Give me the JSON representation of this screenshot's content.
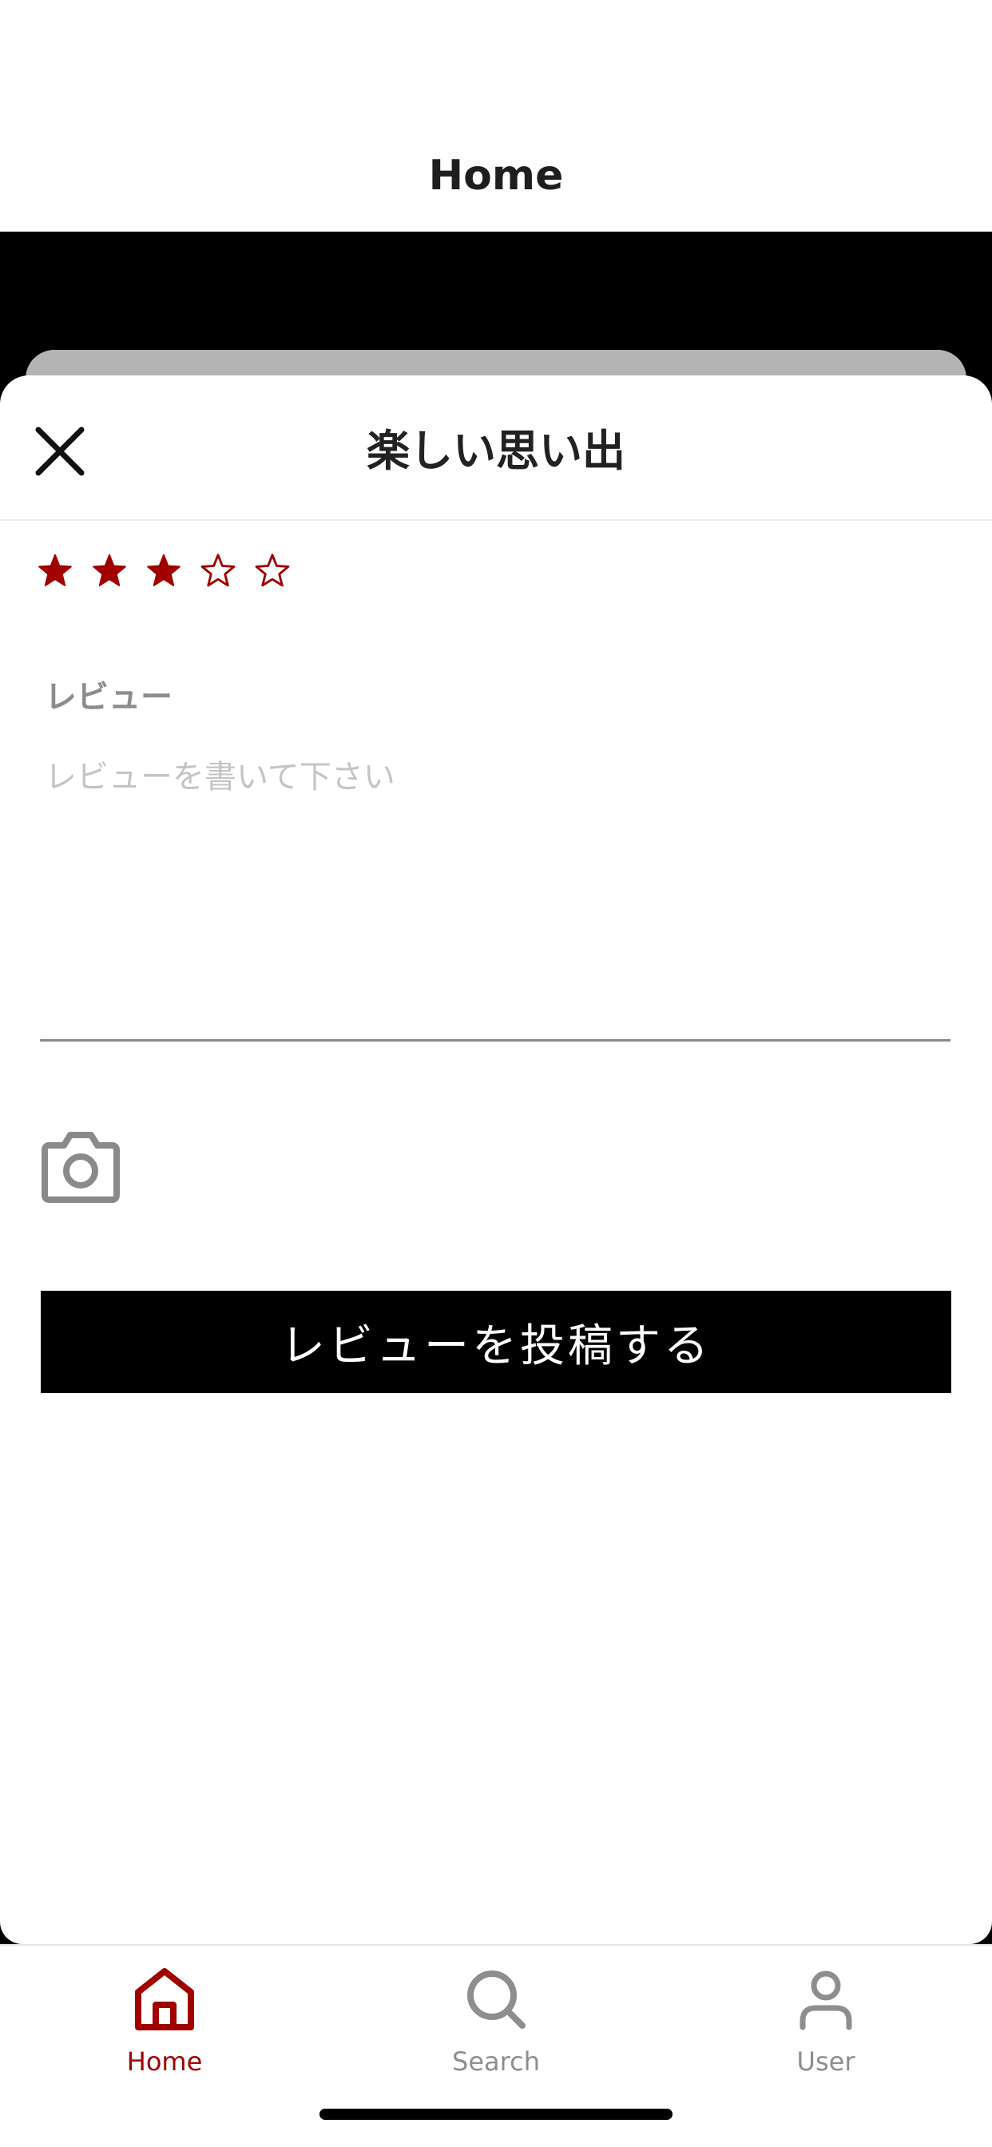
{
  "header": {
    "title": "Home"
  },
  "sheet": {
    "title": "楽しい思い出",
    "close_icon": "close-icon",
    "rating": {
      "value": 3,
      "max": 5,
      "color": "#a00000"
    },
    "review": {
      "label": "レビュー",
      "value": "",
      "placeholder": "レビューを書いて下さい"
    },
    "camera_icon": "camera-icon",
    "submit_label": "レビューを投稿する"
  },
  "tabs": [
    {
      "label": "Home",
      "icon": "home-icon",
      "active": true
    },
    {
      "label": "Search",
      "icon": "search-icon",
      "active": false
    },
    {
      "label": "User",
      "icon": "user-icon",
      "active": false
    }
  ],
  "colors": {
    "accent": "#a00000",
    "inactive": "#8e8e8e",
    "button_bg": "#000000",
    "button_text": "#ffffff"
  }
}
